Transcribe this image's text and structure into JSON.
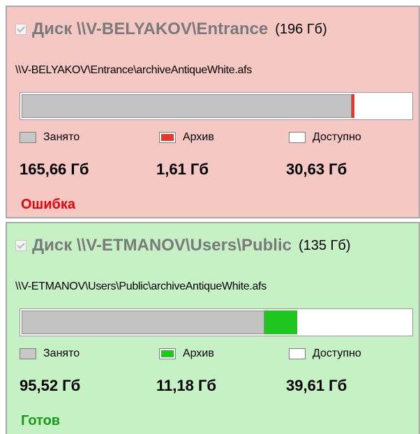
{
  "legend": {
    "used": "Занято",
    "archive": "Архив",
    "free": "Доступно"
  },
  "disks": [
    {
      "title": "Диск \\\\V-BELYAKOV\\Entrance",
      "size": "(196 Гб)",
      "path": "\\\\V-BELYAKOV\\Entrance\\archiveAntiqueWhite.afs",
      "used": "165,66 Гб",
      "archive": "1,61 Гб",
      "free": "30,63 Гб",
      "used_fraction": 0.845,
      "archive_fraction": 0.008,
      "status": "Ошибка",
      "bg_color": "#f5c8c4",
      "archive_color": "#e43a2e",
      "status_color": "#e8000b"
    },
    {
      "title": "Диск \\\\V-ETMANOV\\Users\\Public",
      "size": "(135 Гб)",
      "path": "\\\\V-ETMANOV\\Users\\Public\\archiveAntiqueWhite.afs",
      "used": "95,52 Гб",
      "archive": "11,18 Гб",
      "free": "39,61 Гб",
      "used_fraction": 0.6206,
      "archive_fraction": 0.0848,
      "status": "Готов",
      "bg_color": "#c6f1c4",
      "archive_color": "#1fc71f",
      "status_color": "#1a9a1a"
    }
  ]
}
